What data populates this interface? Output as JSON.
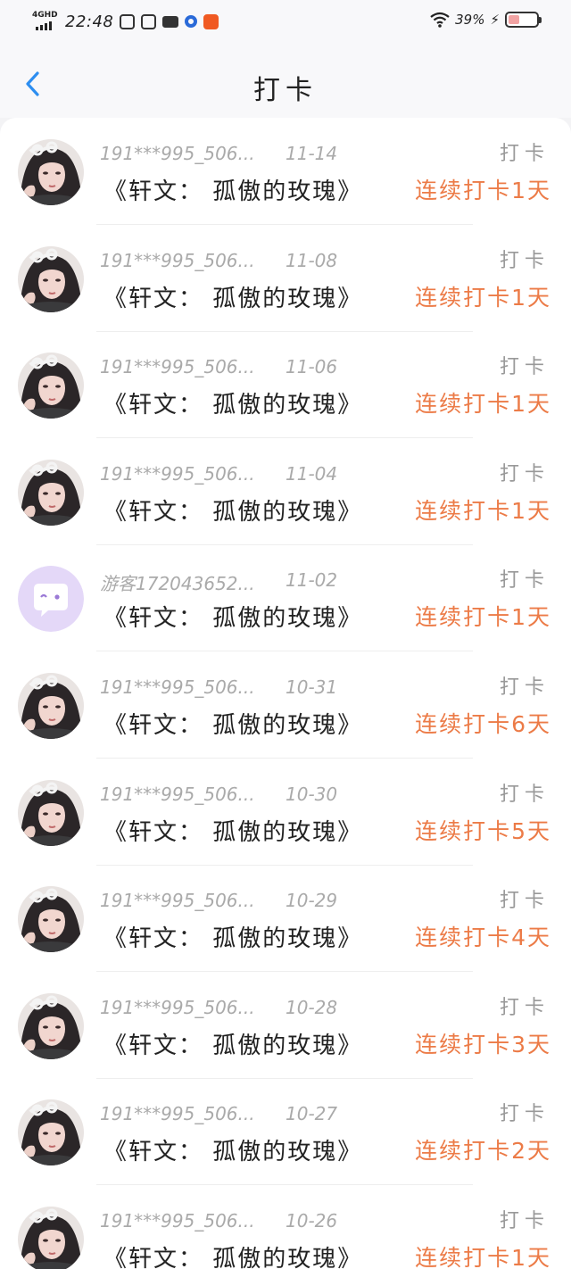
{
  "status_bar": {
    "network": "4GHD",
    "time": "22:48",
    "battery_percent": "39%",
    "battery_level": 0.39,
    "notification_icons": [
      "browser-icon",
      "browser-icon",
      "video-icon",
      "app-dot-icon",
      "app-icon"
    ]
  },
  "header": {
    "title": "打卡"
  },
  "colors": {
    "accent": "#ec7b47",
    "back": "#2d8ef0",
    "avatar_guest_bg": "#e4d8f8"
  },
  "records": [
    {
      "user": "191***995_506...",
      "date": "11-14",
      "book": "《轩文： 孤傲的玫瑰》",
      "tag": "打卡",
      "streak": "连续打卡1天",
      "avatar": "girl-avatar"
    },
    {
      "user": "191***995_506...",
      "date": "11-08",
      "book": "《轩文： 孤傲的玫瑰》",
      "tag": "打卡",
      "streak": "连续打卡1天",
      "avatar": "girl-avatar"
    },
    {
      "user": "191***995_506...",
      "date": "11-06",
      "book": "《轩文： 孤傲的玫瑰》",
      "tag": "打卡",
      "streak": "连续打卡1天",
      "avatar": "girl-avatar"
    },
    {
      "user": "191***995_506...",
      "date": "11-04",
      "book": "《轩文： 孤傲的玫瑰》",
      "tag": "打卡",
      "streak": "连续打卡1天",
      "avatar": "girl-avatar"
    },
    {
      "user": "游客172043652...",
      "date": "11-02",
      "book": "《轩文： 孤傲的玫瑰》",
      "tag": "打卡",
      "streak": "连续打卡1天",
      "avatar": "guest-avatar"
    },
    {
      "user": "191***995_506...",
      "date": "10-31",
      "book": "《轩文： 孤傲的玫瑰》",
      "tag": "打卡",
      "streak": "连续打卡6天",
      "avatar": "girl-avatar"
    },
    {
      "user": "191***995_506...",
      "date": "10-30",
      "book": "《轩文： 孤傲的玫瑰》",
      "tag": "打卡",
      "streak": "连续打卡5天",
      "avatar": "girl-avatar"
    },
    {
      "user": "191***995_506...",
      "date": "10-29",
      "book": "《轩文： 孤傲的玫瑰》",
      "tag": "打卡",
      "streak": "连续打卡4天",
      "avatar": "girl-avatar"
    },
    {
      "user": "191***995_506...",
      "date": "10-28",
      "book": "《轩文： 孤傲的玫瑰》",
      "tag": "打卡",
      "streak": "连续打卡3天",
      "avatar": "girl-avatar"
    },
    {
      "user": "191***995_506...",
      "date": "10-27",
      "book": "《轩文： 孤傲的玫瑰》",
      "tag": "打卡",
      "streak": "连续打卡2天",
      "avatar": "girl-avatar"
    },
    {
      "user": "191***995_506...",
      "date": "10-26",
      "book": "《轩文： 孤傲的玫瑰》",
      "tag": "打卡",
      "streak": "连续打卡1天",
      "avatar": "girl-avatar"
    }
  ]
}
